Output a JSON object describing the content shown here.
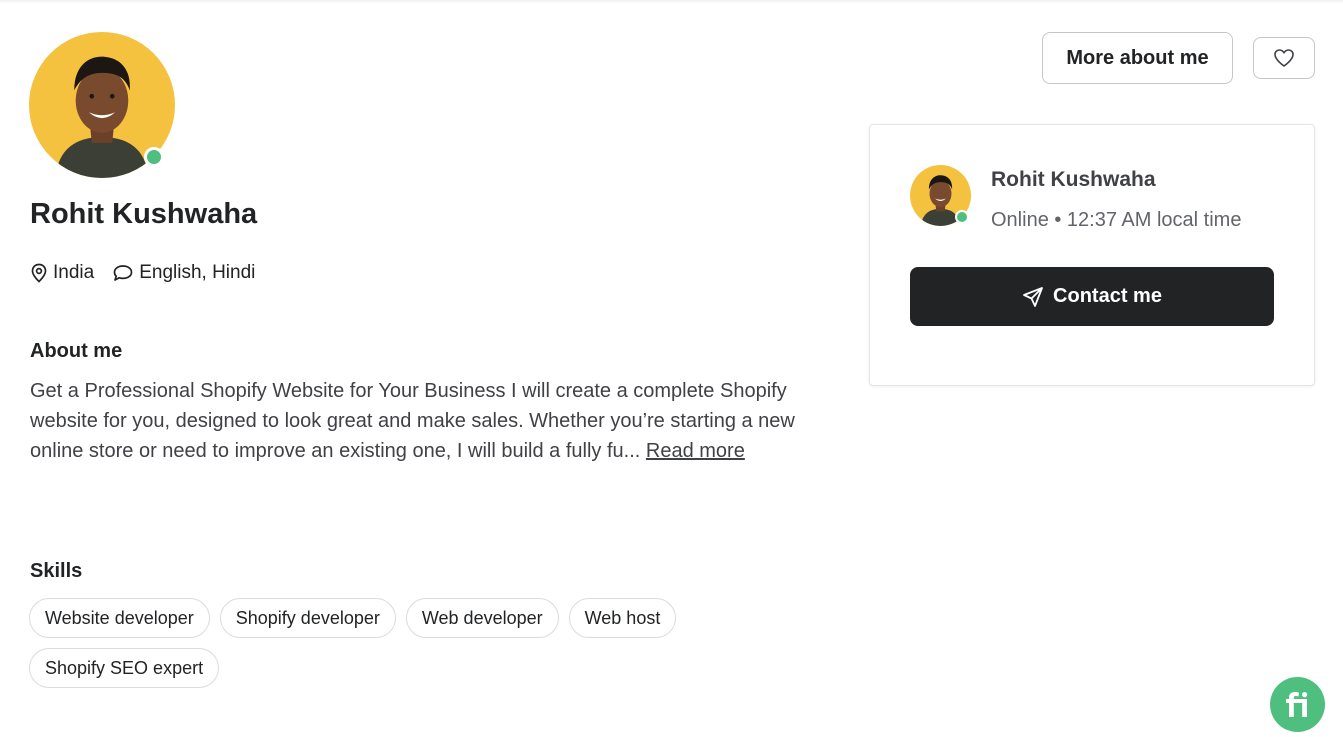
{
  "profile": {
    "name": "Rohit Kushwaha",
    "location": "India",
    "languages": "English, Hindi"
  },
  "about": {
    "title": "About me",
    "line1": "Get a Professional Shopify Website for Your Business I will create a complete Shopify",
    "line2": "website for you, designed to look great and make sales. Whether you’re starting a new online store or need to improve an existing one, I will build a fully fu...",
    "read_more": "Read more"
  },
  "skills": {
    "title": "Skills",
    "items": [
      "Website developer",
      "Shopify developer",
      "Web developer",
      "Web host",
      "Shopify SEO expert"
    ]
  },
  "header": {
    "more_about_label": "More about me"
  },
  "contact_card": {
    "name": "Rohit Kushwaha",
    "status": "Online • 12:37 AM local time",
    "contact_label": "Contact me"
  },
  "colors": {
    "online": "#4fbf7f",
    "avatar_bg": "#f4c23f",
    "primary_button": "#222325"
  },
  "icons": {
    "location": "map-pin-icon",
    "languages": "speech-bubble-icon",
    "favorite": "heart-icon",
    "contact": "send-plane-icon",
    "help": "fiverr-fi-logo"
  }
}
